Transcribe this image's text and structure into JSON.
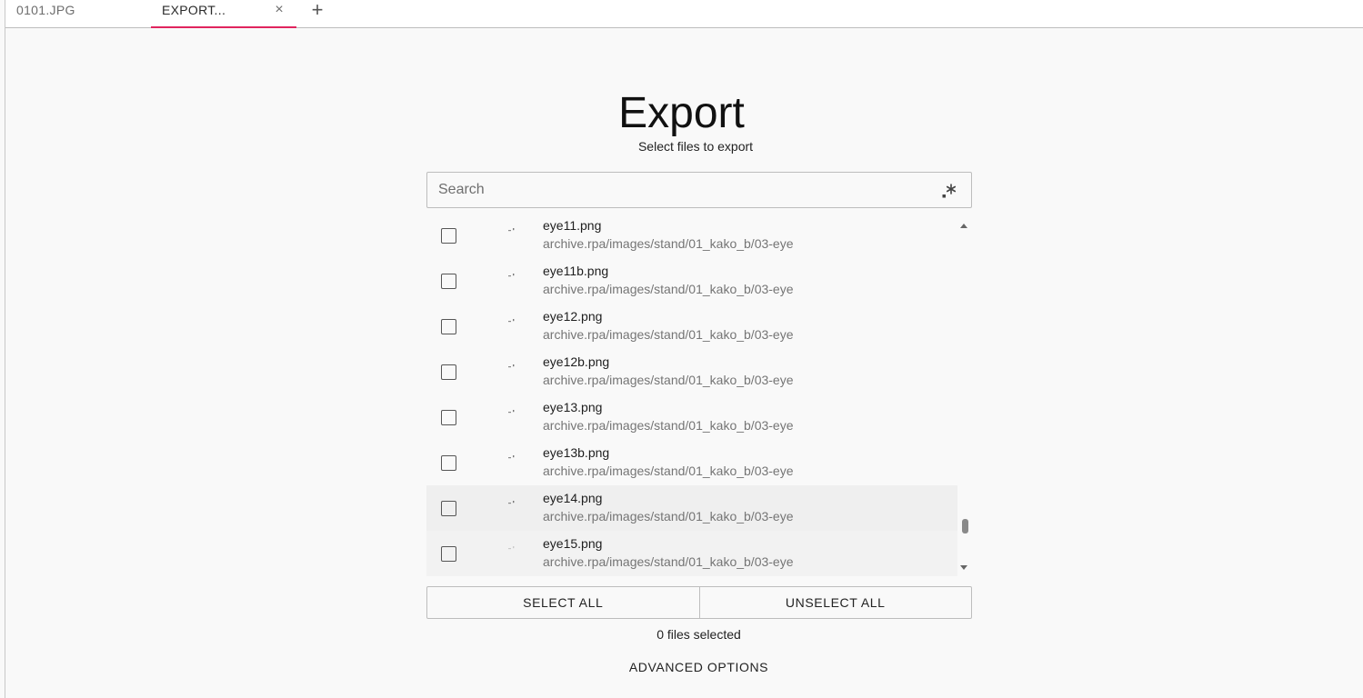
{
  "tabs": [
    {
      "label": "0101.JPG"
    },
    {
      "label": "EXPORT..."
    }
  ],
  "tab_close_glyph": "×",
  "new_tab_glyph": "+",
  "page": {
    "title": "Export",
    "subtitle": "Select files to export"
  },
  "search": {
    "placeholder": "Search",
    "value": "",
    "regex_icon": "regex-icon"
  },
  "files": [
    {
      "name": "eye11.png",
      "path": "archive.rpa/images/stand/01_kako_b/03-eye",
      "checked": false
    },
    {
      "name": "eye11b.png",
      "path": "archive.rpa/images/stand/01_kako_b/03-eye",
      "checked": false
    },
    {
      "name": "eye12.png",
      "path": "archive.rpa/images/stand/01_kako_b/03-eye",
      "checked": false
    },
    {
      "name": "eye12b.png",
      "path": "archive.rpa/images/stand/01_kako_b/03-eye",
      "checked": false
    },
    {
      "name": "eye13.png",
      "path": "archive.rpa/images/stand/01_kako_b/03-eye",
      "checked": false
    },
    {
      "name": "eye13b.png",
      "path": "archive.rpa/images/stand/01_kako_b/03-eye",
      "checked": false
    },
    {
      "name": "eye14.png",
      "path": "archive.rpa/images/stand/01_kako_b/03-eye",
      "checked": false
    },
    {
      "name": "eye15.png",
      "path": "archive.rpa/images/stand/01_kako_b/03-eye",
      "checked": false
    }
  ],
  "buttons": {
    "select_all": "SELECT ALL",
    "unselect_all": "UNSELECT ALL"
  },
  "status": {
    "selected_count": "0 files selected"
  },
  "advanced_options": "ADVANCED OPTIONS",
  "colors": {
    "active_tab_underline": "#e0245e",
    "background": "#f9f9f9"
  }
}
